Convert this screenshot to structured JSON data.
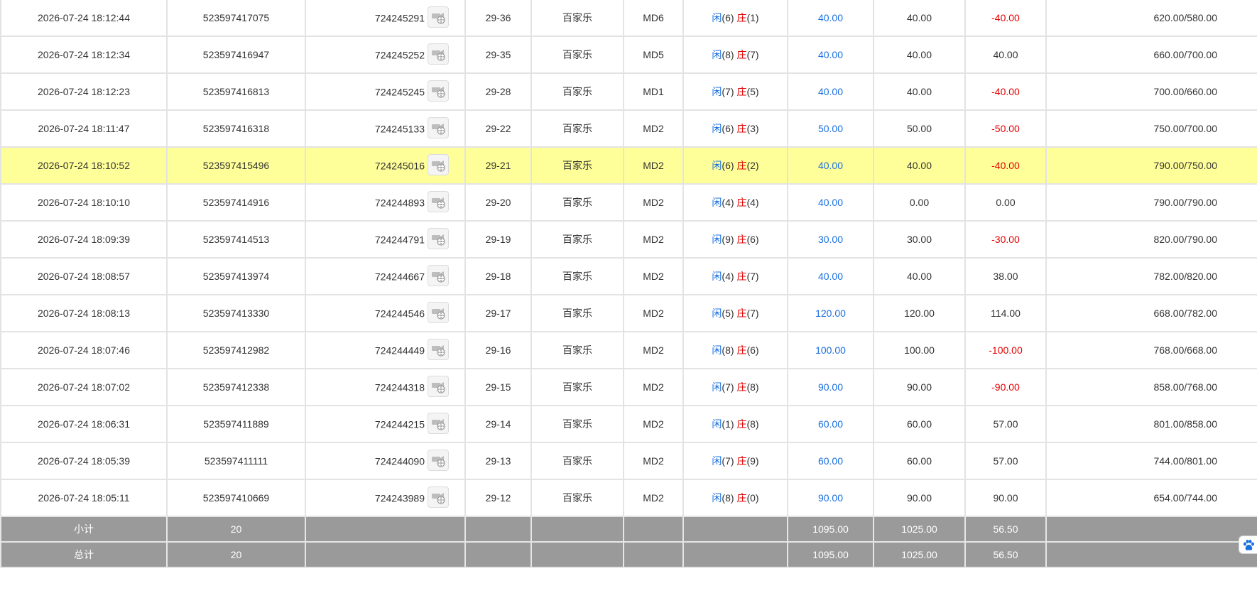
{
  "rows": [
    {
      "time": "2026-07-24 18:12:44",
      "bet_id": "523597417075",
      "round": "724245291",
      "table": "29-36",
      "game": "百家乐",
      "mode": "MD6",
      "player_label": "闲",
      "player_score": "(6)",
      "banker_label": "庄",
      "banker_score": "(1)",
      "bet": "40.00",
      "valid": "40.00",
      "result": "-40.00",
      "result_color": "red",
      "balance": "620.00/580.00",
      "highlight": false
    },
    {
      "time": "2026-07-24 18:12:34",
      "bet_id": "523597416947",
      "round": "724245252",
      "table": "29-35",
      "game": "百家乐",
      "mode": "MD5",
      "player_label": "闲",
      "player_score": "(8)",
      "banker_label": "庄",
      "banker_score": "(7)",
      "bet": "40.00",
      "valid": "40.00",
      "result": "40.00",
      "result_color": "normal",
      "balance": "660.00/700.00",
      "highlight": false
    },
    {
      "time": "2026-07-24 18:12:23",
      "bet_id": "523597416813",
      "round": "724245245",
      "table": "29-28",
      "game": "百家乐",
      "mode": "MD1",
      "player_label": "闲",
      "player_score": "(7)",
      "banker_label": "庄",
      "banker_score": "(5)",
      "bet": "40.00",
      "valid": "40.00",
      "result": "-40.00",
      "result_color": "red",
      "balance": "700.00/660.00",
      "highlight": false
    },
    {
      "time": "2026-07-24 18:11:47",
      "bet_id": "523597416318",
      "round": "724245133",
      "table": "29-22",
      "game": "百家乐",
      "mode": "MD2",
      "player_label": "闲",
      "player_score": "(6)",
      "banker_label": "庄",
      "banker_score": "(3)",
      "bet": "50.00",
      "valid": "50.00",
      "result": "-50.00",
      "result_color": "red",
      "balance": "750.00/700.00",
      "highlight": false
    },
    {
      "time": "2026-07-24 18:10:52",
      "bet_id": "523597415496",
      "round": "724245016",
      "table": "29-21",
      "game": "百家乐",
      "mode": "MD2",
      "player_label": "闲",
      "player_score": "(6)",
      "banker_label": "庄",
      "banker_score": "(2)",
      "bet": "40.00",
      "valid": "40.00",
      "result": "-40.00",
      "result_color": "red",
      "balance": "790.00/750.00",
      "highlight": true
    },
    {
      "time": "2026-07-24 18:10:10",
      "bet_id": "523597414916",
      "round": "724244893",
      "table": "29-20",
      "game": "百家乐",
      "mode": "MD2",
      "player_label": "闲",
      "player_score": "(4)",
      "banker_label": "庄",
      "banker_score": "(4)",
      "bet": "40.00",
      "valid": "0.00",
      "result": "0.00",
      "result_color": "normal",
      "balance": "790.00/790.00",
      "highlight": false
    },
    {
      "time": "2026-07-24 18:09:39",
      "bet_id": "523597414513",
      "round": "724244791",
      "table": "29-19",
      "game": "百家乐",
      "mode": "MD2",
      "player_label": "闲",
      "player_score": "(9)",
      "banker_label": "庄",
      "banker_score": "(6)",
      "bet": "30.00",
      "valid": "30.00",
      "result": "-30.00",
      "result_color": "red",
      "balance": "820.00/790.00",
      "highlight": false
    },
    {
      "time": "2026-07-24 18:08:57",
      "bet_id": "523597413974",
      "round": "724244667",
      "table": "29-18",
      "game": "百家乐",
      "mode": "MD2",
      "player_label": "闲",
      "player_score": "(4)",
      "banker_label": "庄",
      "banker_score": "(7)",
      "bet": "40.00",
      "valid": "40.00",
      "result": "38.00",
      "result_color": "normal",
      "balance": "782.00/820.00",
      "highlight": false
    },
    {
      "time": "2026-07-24 18:08:13",
      "bet_id": "523597413330",
      "round": "724244546",
      "table": "29-17",
      "game": "百家乐",
      "mode": "MD2",
      "player_label": "闲",
      "player_score": "(5)",
      "banker_label": "庄",
      "banker_score": "(7)",
      "bet": "120.00",
      "valid": "120.00",
      "result": "114.00",
      "result_color": "normal",
      "balance": "668.00/782.00",
      "highlight": false
    },
    {
      "time": "2026-07-24 18:07:46",
      "bet_id": "523597412982",
      "round": "724244449",
      "table": "29-16",
      "game": "百家乐",
      "mode": "MD2",
      "player_label": "闲",
      "player_score": "(8)",
      "banker_label": "庄",
      "banker_score": "(6)",
      "bet": "100.00",
      "valid": "100.00",
      "result": "-100.00",
      "result_color": "red",
      "balance": "768.00/668.00",
      "highlight": false
    },
    {
      "time": "2026-07-24 18:07:02",
      "bet_id": "523597412338",
      "round": "724244318",
      "table": "29-15",
      "game": "百家乐",
      "mode": "MD2",
      "player_label": "闲",
      "player_score": "(7)",
      "banker_label": "庄",
      "banker_score": "(8)",
      "bet": "90.00",
      "valid": "90.00",
      "result": "-90.00",
      "result_color": "red",
      "balance": "858.00/768.00",
      "highlight": false
    },
    {
      "time": "2026-07-24 18:06:31",
      "bet_id": "523597411889",
      "round": "724244215",
      "table": "29-14",
      "game": "百家乐",
      "mode": "MD2",
      "player_label": "闲",
      "player_score": "(1)",
      "banker_label": "庄",
      "banker_score": "(8)",
      "bet": "60.00",
      "valid": "60.00",
      "result": "57.00",
      "result_color": "normal",
      "balance": "801.00/858.00",
      "highlight": false
    },
    {
      "time": "2026-07-24 18:05:39",
      "bet_id": "523597411111",
      "round": "724244090",
      "table": "29-13",
      "game": "百家乐",
      "mode": "MD2",
      "player_label": "闲",
      "player_score": "(7)",
      "banker_label": "庄",
      "banker_score": "(9)",
      "bet": "60.00",
      "valid": "60.00",
      "result": "57.00",
      "result_color": "normal",
      "balance": "744.00/801.00",
      "highlight": false
    },
    {
      "time": "2026-07-24 18:05:11",
      "bet_id": "523597410669",
      "round": "724243989",
      "table": "29-12",
      "game": "百家乐",
      "mode": "MD2",
      "player_label": "闲",
      "player_score": "(8)",
      "banker_label": "庄",
      "banker_score": "(0)",
      "bet": "90.00",
      "valid": "90.00",
      "result": "90.00",
      "result_color": "normal",
      "balance": "654.00/744.00",
      "highlight": false
    }
  ],
  "subtotal": {
    "label": "小计",
    "count": "20",
    "bet": "1095.00",
    "valid": "1025.00",
    "result": "56.50"
  },
  "total": {
    "label": "总计",
    "count": "20",
    "bet": "1095.00",
    "valid": "1025.00",
    "result": "56.50"
  },
  "icons": {
    "replay": "video-replay-icon",
    "side_widget": "paw-icon"
  },
  "colors": {
    "highlight": "#ffff99",
    "blue": "#1a6fe0",
    "red": "#e60000",
    "summary_bg": "#9a9a9a"
  }
}
